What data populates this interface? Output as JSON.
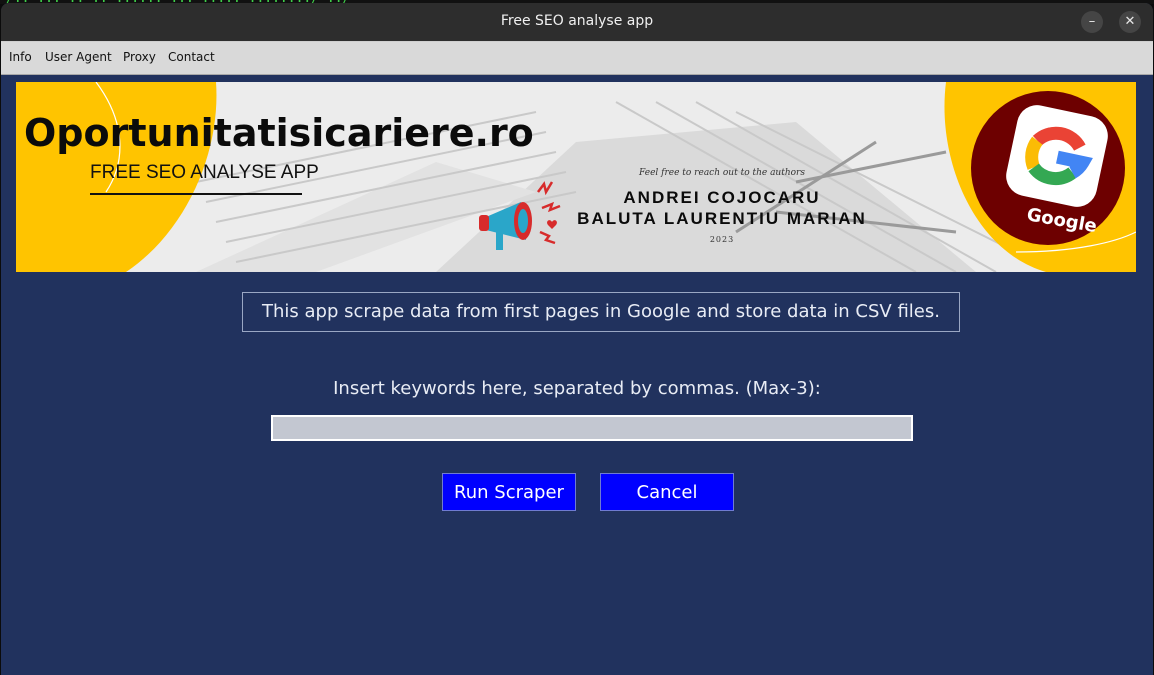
{
  "terminal": {
    "fragment": "/.. ... .. .. ...... ... ..... ......../ ../"
  },
  "window": {
    "title": "Free SEO analyse app"
  },
  "window_controls": {
    "minimize_symbol": "–",
    "close_symbol": "✕"
  },
  "menu": {
    "items": [
      {
        "label": "Info"
      },
      {
        "label": "User Agent"
      },
      {
        "label": "Proxy"
      },
      {
        "label": "Contact"
      }
    ]
  },
  "banner": {
    "site": "Oportunitatisicariere.ro",
    "subtitle": "FREE SEO ANALYSE APP",
    "tagline": "Feel free to reach out to the authors",
    "author1": "ANDREI COJOCARU",
    "author2": "BALUTA LAURENTIU MARIAN",
    "year": "2023",
    "google_label": "Google"
  },
  "main": {
    "intro": "This app scrape data from first pages in Google and store data in CSV files.",
    "keywords_label": "Insert keywords here, separated by commas. (Max-3):",
    "keywords_value": "",
    "run_label": "Run Scraper",
    "cancel_label": "Cancel"
  },
  "colors": {
    "window_bg": "#21325e",
    "button_bg": "#0000ff",
    "banner_yellow": "#ffc400",
    "google_circle": "#6d0000"
  }
}
